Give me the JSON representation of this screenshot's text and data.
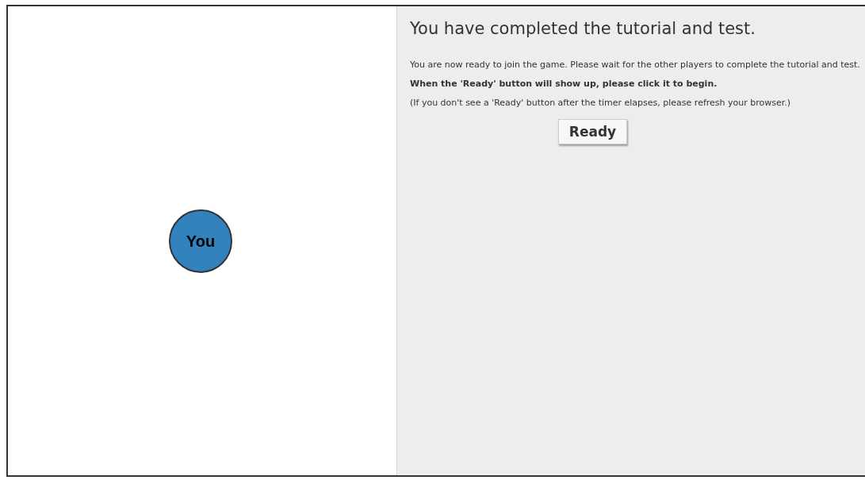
{
  "canvas": {
    "nodes": [
      {
        "label": "You",
        "color": "#3182bd"
      }
    ]
  },
  "panel": {
    "title": "You have completed the tutorial and test.",
    "paragraphs": [
      {
        "text": "You are now ready to join the game. Please wait for the other players to complete the tutorial and test.",
        "kind": "plain"
      },
      {
        "text": "When the 'Ready' button will show up, please click it to begin.",
        "kind": "bold"
      },
      {
        "text": "(If you don't see a 'Ready' button after the timer elapses, please refresh your browser.)",
        "kind": "plain"
      }
    ],
    "button": "Ready"
  }
}
